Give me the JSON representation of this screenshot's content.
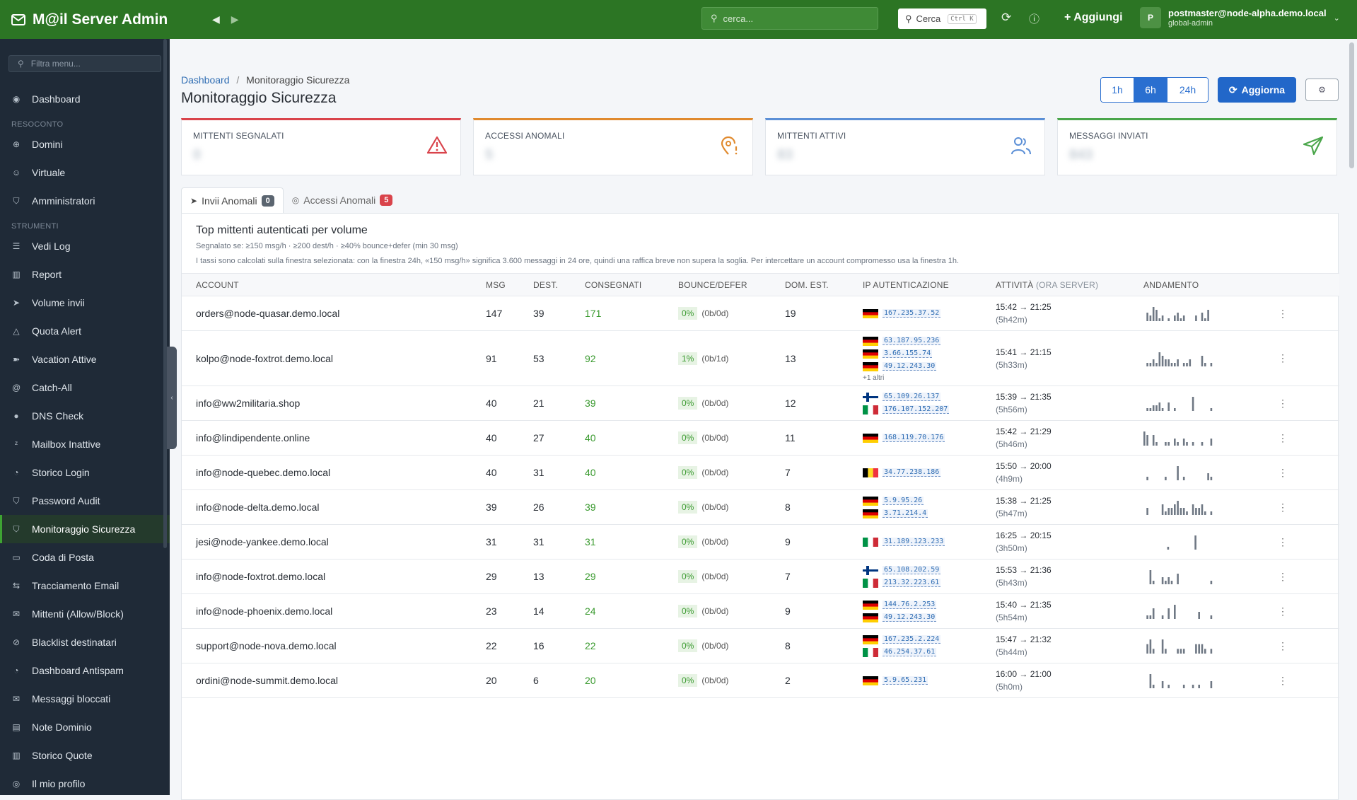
{
  "app": {
    "title": "M@il Server Admin",
    "search_placeholder": "cerca...",
    "cerca_label": "Cerca",
    "cerca_kbd": "Ctrl K",
    "add_label": "+ Aggiungi",
    "user_email": "postmaster@node-alpha.demo.local",
    "user_role": "global-admin",
    "avatar_letter": "P"
  },
  "sidebar": {
    "filter_placeholder": "Filtra menu...",
    "dashboard": "Dashboard",
    "sec1": "RESOCONTO",
    "sec2": "STRUMENTI",
    "items1": [
      "Domini",
      "Virtuale",
      "Amministratori"
    ],
    "items2": [
      "Vedi Log",
      "Report",
      "Volume invii",
      "Quota Alert",
      "Vacation Attive",
      "Catch-All",
      "DNS Check",
      "Mailbox Inattive",
      "Storico Login",
      "Password Audit",
      "Monitoraggio Sicurezza",
      "Coda di Posta",
      "Tracciamento Email",
      "Mittenti (Allow/Block)",
      "Blacklist destinatari",
      "Dashboard Antispam",
      "Messaggi bloccati",
      "Note Dominio",
      "Storico Quote",
      "Il mio profilo"
    ]
  },
  "header": {
    "crumb_home": "Dashboard",
    "crumb_sep": "/",
    "crumb_current": "Monitoraggio Sicurezza",
    "title": "Monitoraggio Sicurezza",
    "ranges": [
      "1h",
      "6h",
      "24h"
    ],
    "range_active": "6h",
    "refresh": "Aggiorna"
  },
  "cards": [
    {
      "label": "MITTENTI SEGNALATI",
      "value": "0",
      "color": "#d9434b",
      "icon": "warning-icon"
    },
    {
      "label": "ACCESSI ANOMALI",
      "value": "5",
      "color": "#e08a2e",
      "icon": "location-alert-icon"
    },
    {
      "label": "MITTENTI ATTIVI",
      "value": "83",
      "color": "#5b8fd6",
      "icon": "users-icon"
    },
    {
      "label": "MESSAGGI INVIATI",
      "value": "843",
      "color": "#4aa64a",
      "icon": "send-icon"
    }
  ],
  "tabs": [
    {
      "label": "Invii Anomali",
      "count": "0"
    },
    {
      "label": "Accessi Anomali",
      "count": "5"
    }
  ],
  "panel": {
    "title": "Top mittenti autenticati per volume",
    "subtitle": "Segnalato se: ≥150 msg/h · ≥200 dest/h · ≥40% bounce+defer (min 30 msg)",
    "note": "I tassi sono calcolati sulla finestra selezionata: con la finestra 24h, «150 msg/h» significa 3.600 messaggi in 24 ore, quindi una raffica breve non supera la soglia. Per intercettare un account compromesso usa la finestra 1h."
  },
  "columns": [
    "ACCOUNT",
    "MSG",
    "DEST.",
    "CONSEGNATI",
    "BOUNCE/DEFER",
    "DOM. EST.",
    "IP AUTENTICAZIONE",
    "ATTIVITÀ",
    "(ORA SERVER)",
    "ANDAMENTO"
  ],
  "rows": [
    {
      "account": "orders@node-quasar.demo.local",
      "msg": "147",
      "dest": "39",
      "cons": "171",
      "pct": "0%",
      "bd": "(0b/0d)",
      "dom": "19",
      "ips": [
        {
          "flag": "de",
          "ip": "167.235.37.52"
        }
      ],
      "more": "",
      "time": "15:42 → 21:25",
      "dur": "(5h42m)",
      "spark": [
        0,
        3,
        2,
        5,
        4,
        1,
        2,
        0,
        1,
        0,
        2,
        3,
        1,
        2,
        0,
        0,
        0,
        2,
        0,
        3,
        1,
        4,
        0
      ]
    },
    {
      "account": "kolpo@node-foxtrot.demo.local",
      "msg": "91",
      "dest": "53",
      "cons": "92",
      "pct": "1%",
      "bd": "(0b/1d)",
      "dom": "13",
      "ips": [
        {
          "flag": "de",
          "ip": "63.187.95.236"
        },
        {
          "flag": "de",
          "ip": "3.66.155.74"
        },
        {
          "flag": "de",
          "ip": "49.12.243.30"
        }
      ],
      "more": "+1 altri",
      "time": "15:41 → 21:15",
      "dur": "(5h33m)",
      "spark": [
        0,
        1,
        1,
        2,
        1,
        4,
        3,
        2,
        2,
        1,
        1,
        2,
        0,
        1,
        1,
        2,
        0,
        0,
        0,
        3,
        1,
        0,
        1
      ]
    },
    {
      "account": "info@ww2militaria.shop",
      "msg": "40",
      "dest": "21",
      "cons": "39",
      "pct": "0%",
      "bd": "(0b/0d)",
      "dom": "12",
      "ips": [
        {
          "flag": "fi",
          "ip": "65.109.26.137"
        },
        {
          "flag": "it",
          "ip": "176.107.152.207"
        }
      ],
      "more": "",
      "time": "15:39 → 21:35",
      "dur": "(5h56m)",
      "spark": [
        0,
        1,
        1,
        2,
        2,
        3,
        1,
        0,
        3,
        0,
        1,
        0,
        0,
        0,
        0,
        0,
        5,
        0,
        0,
        0,
        0,
        0,
        1
      ]
    },
    {
      "account": "info@lindipendente.online",
      "msg": "40",
      "dest": "27",
      "cons": "40",
      "pct": "0%",
      "bd": "(0b/0d)",
      "dom": "11",
      "ips": [
        {
          "flag": "de",
          "ip": "168.119.70.176"
        }
      ],
      "more": "",
      "time": "15:42 → 21:29",
      "dur": "(5h46m)",
      "spark": [
        4,
        3,
        0,
        3,
        1,
        0,
        0,
        1,
        1,
        0,
        2,
        1,
        0,
        2,
        1,
        0,
        1,
        0,
        0,
        1,
        0,
        0,
        2
      ]
    },
    {
      "account": "info@node-quebec.demo.local",
      "msg": "40",
      "dest": "31",
      "cons": "40",
      "pct": "0%",
      "bd": "(0b/0d)",
      "dom": "7",
      "ips": [
        {
          "flag": "be",
          "ip": "34.77.238.186"
        }
      ],
      "more": "",
      "time": "15:50 → 20:00",
      "dur": "(4h9m)",
      "spark": [
        0,
        1,
        0,
        0,
        0,
        0,
        0,
        1,
        0,
        0,
        0,
        4,
        0,
        1,
        0,
        0,
        0,
        0,
        0,
        0,
        0,
        2,
        1
      ]
    },
    {
      "account": "info@node-delta.demo.local",
      "msg": "39",
      "dest": "26",
      "cons": "39",
      "pct": "0%",
      "bd": "(0b/0d)",
      "dom": "8",
      "ips": [
        {
          "flag": "de",
          "ip": "5.9.95.26"
        },
        {
          "flag": "de",
          "ip": "3.71.214.4"
        }
      ],
      "more": "",
      "time": "15:38 → 21:25",
      "dur": "(5h47m)",
      "spark": [
        0,
        2,
        0,
        0,
        0,
        0,
        3,
        1,
        2,
        2,
        3,
        4,
        2,
        2,
        1,
        0,
        3,
        2,
        2,
        3,
        1,
        0,
        1
      ]
    },
    {
      "account": "jesi@node-yankee.demo.local",
      "msg": "31",
      "dest": "31",
      "cons": "31",
      "pct": "0%",
      "bd": "(0b/0d)",
      "dom": "9",
      "ips": [
        {
          "flag": "it",
          "ip": "31.189.123.233"
        }
      ],
      "more": "",
      "time": "16:25 → 20:15",
      "dur": "(3h50m)",
      "spark": [
        0,
        0,
        0,
        0,
        0,
        0,
        0,
        0,
        0,
        0,
        0,
        0,
        0,
        0,
        0,
        0,
        0,
        0,
        0,
        0,
        0,
        0,
        0
      ],
      "spark_marks": [
        [
          2,
          1
        ],
        [
          11,
          5
        ]
      ]
    },
    {
      "account": "info@node-foxtrot.demo.local",
      "msg": "29",
      "dest": "13",
      "cons": "29",
      "pct": "0%",
      "bd": "(0b/0d)",
      "dom": "7",
      "ips": [
        {
          "flag": "fi",
          "ip": "65.108.202.59"
        },
        {
          "flag": "it",
          "ip": "213.32.223.61"
        }
      ],
      "more": "",
      "time": "15:53 → 21:36",
      "dur": "(5h43m)",
      "spark": [
        0,
        0,
        4,
        1,
        0,
        0,
        2,
        1,
        2,
        1,
        0,
        3,
        0,
        0,
        0,
        0,
        0,
        0,
        0,
        0,
        0,
        0,
        1
      ]
    },
    {
      "account": "info@node-phoenix.demo.local",
      "msg": "23",
      "dest": "14",
      "cons": "24",
      "pct": "0%",
      "bd": "(0b/0d)",
      "dom": "9",
      "ips": [
        {
          "flag": "de",
          "ip": "144.76.2.253"
        },
        {
          "flag": "de",
          "ip": "49.12.243.30"
        }
      ],
      "more": "",
      "time": "15:40 → 21:35",
      "dur": "(5h54m)",
      "spark": [
        0,
        1,
        1,
        3,
        0,
        0,
        1,
        0,
        3,
        0,
        4,
        0,
        0,
        0,
        0,
        0,
        0,
        0,
        2,
        0,
        0,
        0,
        1
      ]
    },
    {
      "account": "support@node-nova.demo.local",
      "msg": "22",
      "dest": "16",
      "cons": "22",
      "pct": "0%",
      "bd": "(0b/0d)",
      "dom": "8",
      "ips": [
        {
          "flag": "de",
          "ip": "167.235.2.224"
        },
        {
          "flag": "it",
          "ip": "46.254.37.61"
        }
      ],
      "more": "",
      "time": "15:47 → 21:32",
      "dur": "(5h44m)",
      "spark": [
        0,
        2,
        3,
        1,
        0,
        0,
        3,
        1,
        0,
        0,
        0,
        1,
        1,
        1,
        0,
        0,
        0,
        2,
        2,
        2,
        1,
        0,
        1
      ]
    },
    {
      "account": "ordini@node-summit.demo.local",
      "msg": "20",
      "dest": "6",
      "cons": "20",
      "pct": "0%",
      "bd": "(0b/0d)",
      "dom": "2",
      "ips": [
        {
          "flag": "de",
          "ip": "5.9.65.231"
        }
      ],
      "more": "",
      "time": "16:00 → 21:00",
      "dur": "(5h0m)",
      "spark": [
        0,
        0,
        4,
        1,
        0,
        0,
        2,
        0,
        1,
        0,
        0,
        0,
        0,
        1,
        0,
        0,
        1,
        0,
        1,
        0,
        0,
        0,
        2
      ]
    }
  ],
  "colors": {
    "topbar": "#2c7524",
    "sidebar": "#1f2a37",
    "accent": "#2267c9",
    "green": "#3a9a2f"
  }
}
